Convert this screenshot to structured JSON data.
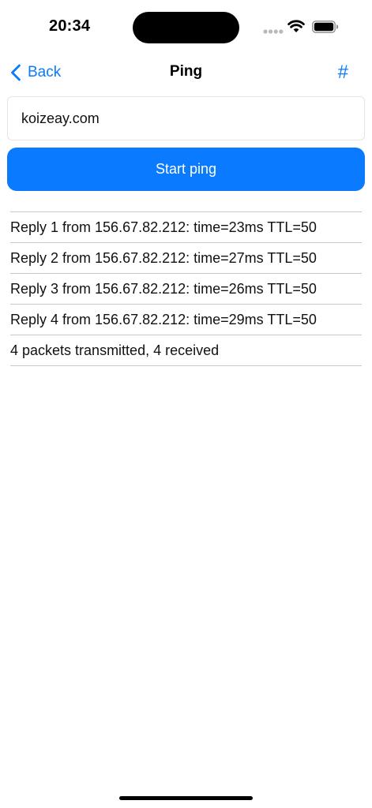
{
  "status_bar": {
    "time": "20:34"
  },
  "nav": {
    "back_label": "Back",
    "title": "Ping",
    "hash_label": "#"
  },
  "host_input": {
    "value": "koizeay.com",
    "placeholder": ""
  },
  "start_button": {
    "label": "Start ping"
  },
  "results": [
    "Reply 1 from 156.67.82.212: time=23ms TTL=50",
    "Reply 2 from 156.67.82.212: time=27ms TTL=50",
    "Reply 3 from 156.67.82.212: time=26ms TTL=50",
    "Reply 4 from 156.67.82.212: time=29ms TTL=50",
    "4 packets transmitted, 4 received"
  ],
  "icons": {
    "back": "chevron-left-icon",
    "signal": "signal-dots-icon",
    "wifi": "wifi-icon",
    "battery": "battery-icon"
  },
  "colors": {
    "accent": "#0a7aff",
    "separator": "#c8c8cc"
  }
}
